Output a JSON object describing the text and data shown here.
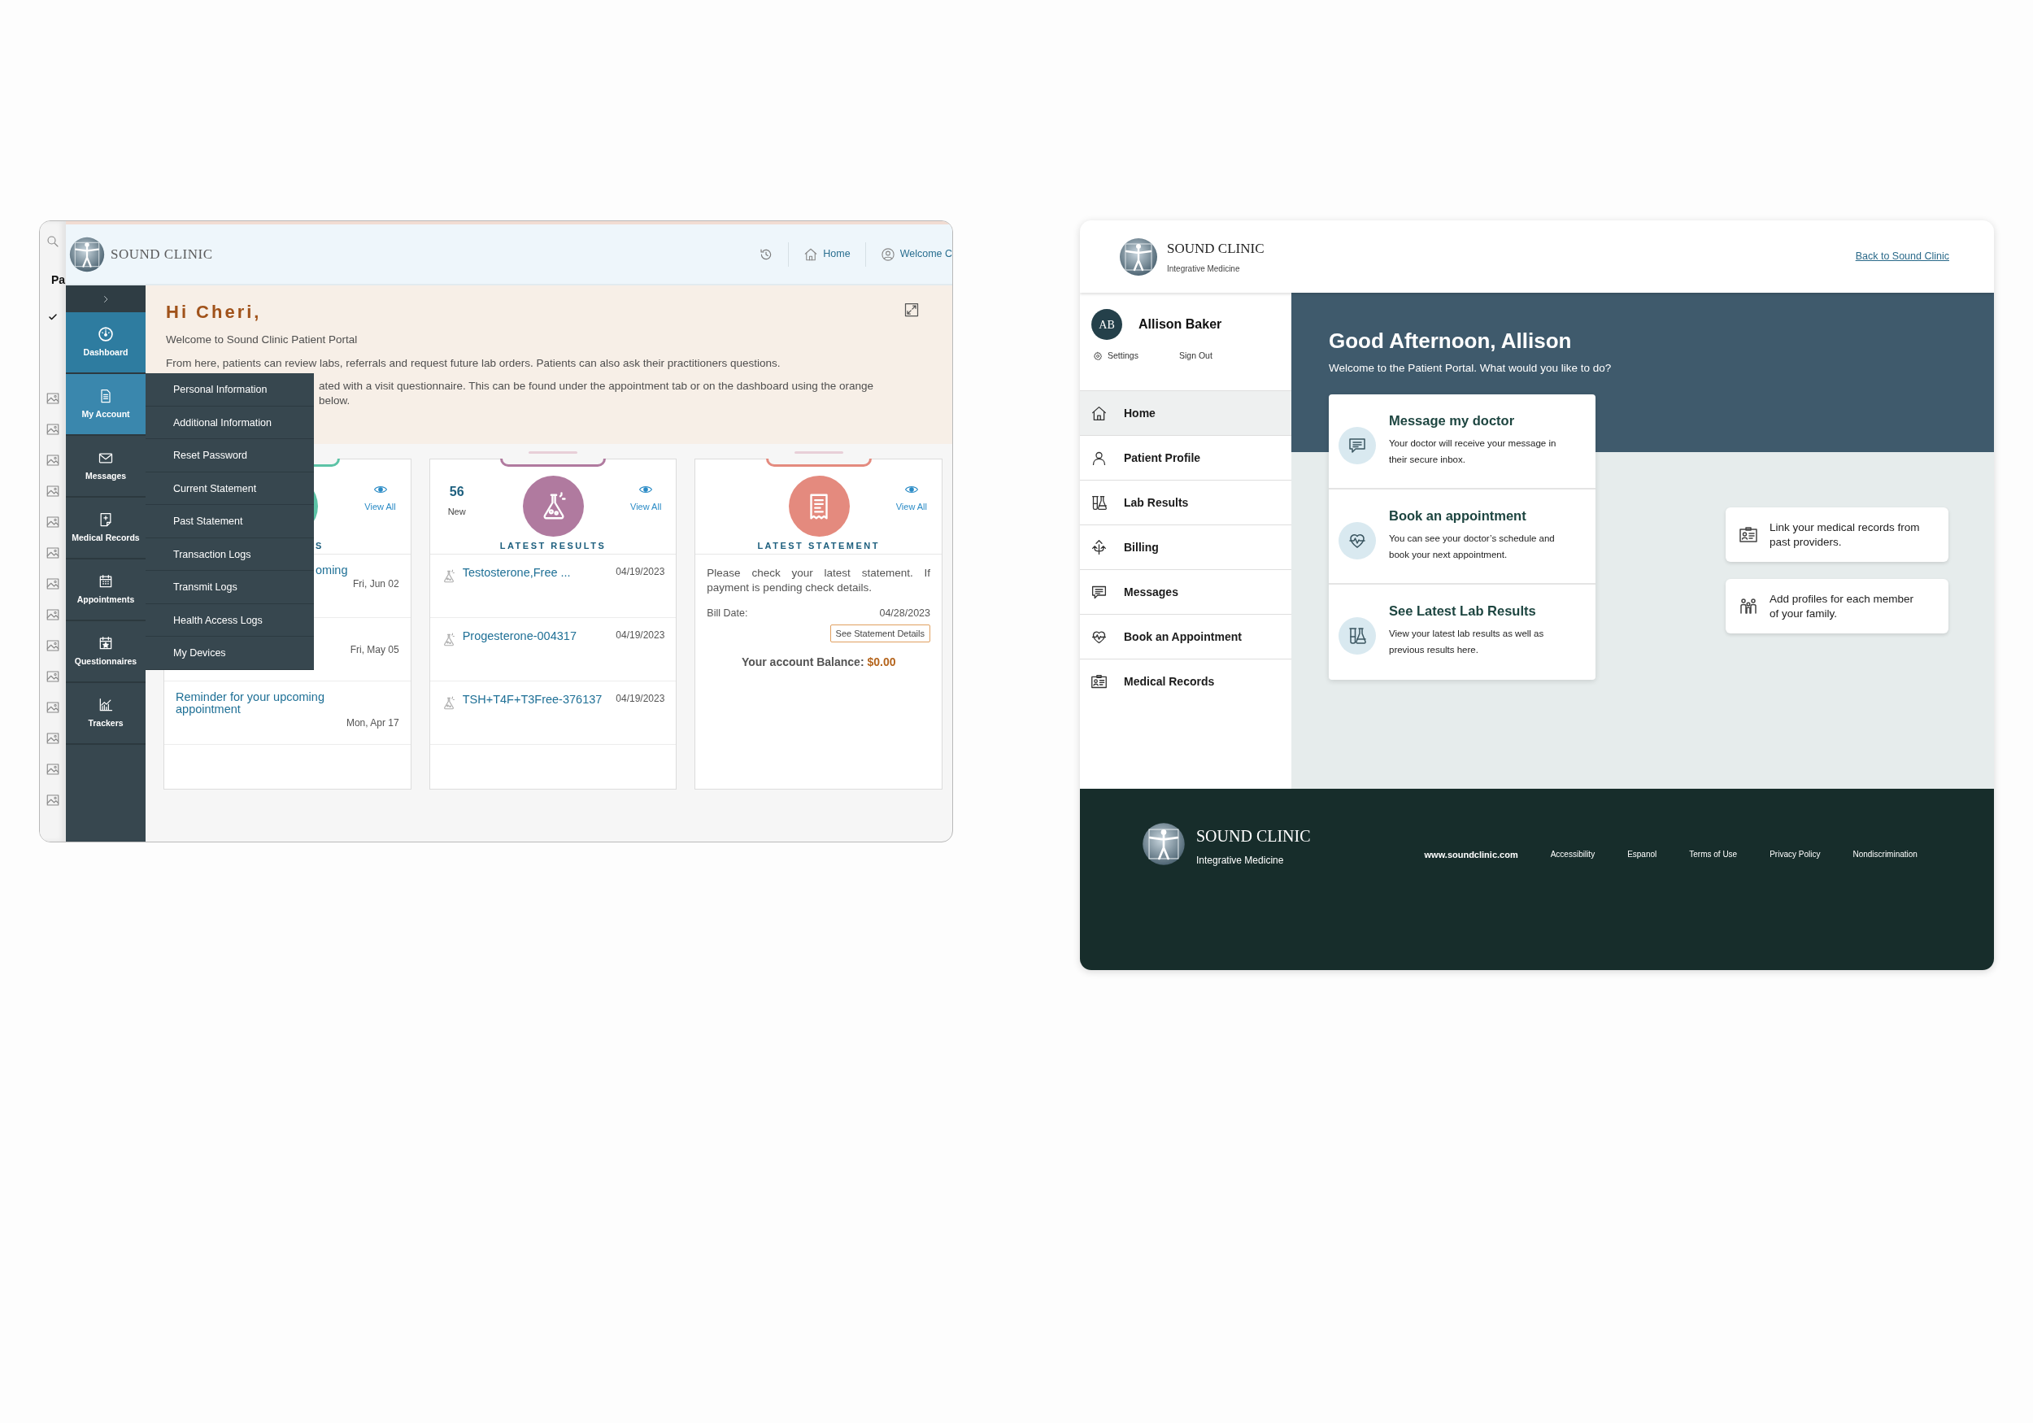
{
  "left_window": {
    "background_window": {
      "label": "Pa"
    },
    "header": {
      "brand": "SOUND CLINIC",
      "nav": [
        {
          "label": "Home"
        },
        {
          "label": "Welcome C"
        }
      ]
    },
    "sidebar": {
      "items": [
        {
          "label": "Dashboard",
          "selected": true,
          "expanded": false
        },
        {
          "label": "My Account",
          "selected": false,
          "expanded": true
        },
        {
          "label": "Messages",
          "selected": false,
          "expanded": false
        },
        {
          "label": "Medical Records",
          "selected": false,
          "expanded": false
        },
        {
          "label": "Appointments",
          "selected": false,
          "expanded": false
        },
        {
          "label": "Questionnaires",
          "selected": false,
          "expanded": false
        },
        {
          "label": "Trackers",
          "selected": false,
          "expanded": false
        }
      ]
    },
    "submenu": [
      "Personal Information",
      "Additional Information",
      "Reset Password",
      "Current Statement",
      "Past Statement",
      "Transaction Logs",
      "Transmit Logs",
      "Health Access Logs",
      "My Devices"
    ],
    "welcome": {
      "title": "Hi Cheri,",
      "subtitle": "Welcome to Sound Clinic Patient Portal",
      "paragraphs": [
        {
          "text": "From here, patients can review labs, referrals and request future lab orders. Patients can also ask their practitioners questions.",
          "clipped": false
        },
        {
          "text": "ated with a visit questionnaire. This can be found under the appointment tab or on the dashboard using the orange below.",
          "clipped": true
        }
      ]
    },
    "cards": [
      {
        "kind": "appointments",
        "color": "#5cc3a6",
        "title": "S",
        "title_clipped": true,
        "view_all": "View All",
        "rows": [
          {
            "title": "oming",
            "date": "Fri, Jun 02",
            "clipped": true
          },
          {
            "date": "Fri, May 05",
            "clipped": true
          },
          {
            "title": "Reminder for your upcoming appointment",
            "date": "Mon, Apr 17",
            "clipped": false
          }
        ]
      },
      {
        "kind": "results",
        "color": "#b07a9f",
        "count": "56",
        "count_label": "New",
        "title": "LATEST RESULTS",
        "title_clipped": false,
        "view_all": "View All",
        "rows": [
          {
            "title": "Testosterone,Free ...",
            "date": "04/19/2023",
            "clipped": false
          },
          {
            "title": "Progesterone-004317",
            "date": "04/19/2023",
            "clipped": false
          },
          {
            "title": "TSH+T4F+T3Free-376137",
            "date": "04/19/2023",
            "clipped": false
          }
        ]
      },
      {
        "kind": "statement",
        "color": "#e48a7e",
        "title": "LATEST STATEMENT",
        "title_clipped": false,
        "view_all": "View All",
        "text": "Please check your latest statement. If payment is pending check details.",
        "bill_label": "Bill Date:",
        "bill_date": "04/28/2023",
        "button": "See Statement Details",
        "balance_label": "Your account Balance:",
        "balance_value": "$0.00"
      }
    ]
  },
  "right_window": {
    "header": {
      "brand": "SOUND CLINIC",
      "tagline": "Integrative Medicine",
      "link": "Back to Sound Clinic"
    },
    "profile": {
      "initials": "AB",
      "name": "Allison Baker",
      "settings": "Settings",
      "sign_out": "Sign Out"
    },
    "nav": [
      {
        "label": "Home",
        "selected": true
      },
      {
        "label": "Patient Profile",
        "selected": false
      },
      {
        "label": "Lab Results",
        "selected": false
      },
      {
        "label": "Billing",
        "selected": false
      },
      {
        "label": "Messages",
        "selected": false
      },
      {
        "label": "Book an Appointment",
        "selected": false
      },
      {
        "label": "Medical Records",
        "selected": false
      }
    ],
    "hero": {
      "title": "Good Afternoon, Allison",
      "subtitle": "Welcome to the Patient Portal. What would you like to do?"
    },
    "actions": [
      {
        "title": "Message my doctor",
        "text": "Your doctor will receive your message in their secure inbox."
      },
      {
        "title": "Book an appointment",
        "text": "You can see your doctor’s schedule and book your next appointment."
      },
      {
        "title": "See Latest Lab Results",
        "text": "View your latest lab results as well as previous results here."
      }
    ],
    "shortcuts": [
      {
        "text": "Link your medical records from past providers."
      },
      {
        "text": "Add profiles for each member of your family."
      }
    ],
    "footer": {
      "brand": "SOUND CLINIC",
      "tagline": "Integrative Medicine",
      "links": [
        "www.soundclinic.com",
        "Accessibility",
        "Espanol",
        "Terms of Use",
        "Privacy Policy",
        "Nondiscrimination"
      ]
    }
  }
}
